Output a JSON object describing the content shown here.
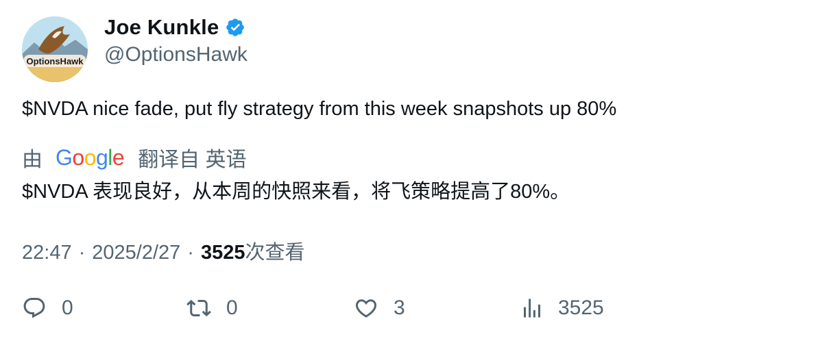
{
  "author": {
    "display_name": "Joe Kunkle",
    "handle": "@OptionsHawk",
    "avatar_text": "OptionsHawk"
  },
  "tweet": {
    "text": "$NVDA nice fade, put fly strategy from this week snapshots up 80%"
  },
  "translation": {
    "by_label": "由",
    "provider": "Google",
    "from_label": "翻译自 英语",
    "text": "$NVDA 表现良好，从本周的快照来看，将飞策略提高了80%。"
  },
  "meta": {
    "time": "22:47",
    "separator": "·",
    "date": "2025/2/27",
    "views_count": "3525",
    "views_label": "次查看"
  },
  "actions": {
    "replies": "0",
    "retweets": "0",
    "likes": "3",
    "views": "3525"
  },
  "colors": {
    "verified": "#1d9bf0",
    "secondary_text": "#536471",
    "primary_text": "#0f1419"
  },
  "icons": [
    "verified-badge-icon",
    "reply-icon",
    "retweet-icon",
    "like-icon",
    "views-icon"
  ]
}
